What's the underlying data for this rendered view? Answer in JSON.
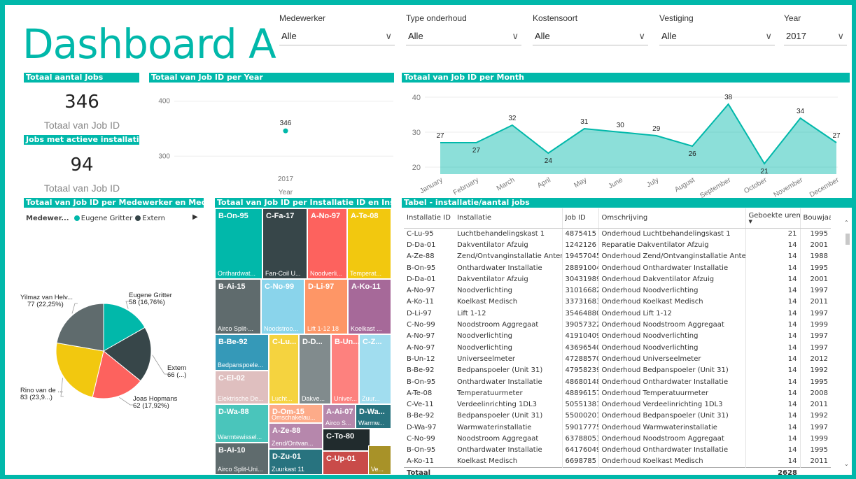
{
  "dashboard_title": "Dashboard A",
  "slicers": [
    {
      "label": "Medewerker",
      "value": "Alle"
    },
    {
      "label": "Type onderhoud",
      "value": "Alle"
    },
    {
      "label": "Kostensoort",
      "value": "Alle"
    },
    {
      "label": "Vestiging",
      "value": "Alle"
    },
    {
      "label": "Year",
      "value": "2017"
    }
  ],
  "cards": [
    {
      "title": "Totaal aantal Jobs",
      "value": "346",
      "caption": "Totaal van Job ID"
    },
    {
      "title": "Jobs met actieve installatie",
      "value": "94",
      "caption": "Totaal van Job ID"
    }
  ],
  "year_chart": {
    "title": "Totaal van Job ID per Year",
    "chart_data": {
      "type": "scatter",
      "categories": [
        "2017"
      ],
      "values": [
        346
      ],
      "xlabel": "Year",
      "ylim": [
        280,
        420
      ],
      "yticks": [
        "400",
        "300"
      ]
    }
  },
  "month_chart": {
    "title": "Totaal van Job ID per Month",
    "chart_data": {
      "type": "area",
      "categories": [
        "January",
        "February",
        "March",
        "April",
        "May",
        "June",
        "July",
        "August",
        "September",
        "October",
        "November",
        "December"
      ],
      "values": [
        27,
        27,
        32,
        24,
        31,
        30,
        29,
        26,
        38,
        21,
        34,
        27
      ],
      "ylim": [
        18,
        42
      ],
      "yticks": [
        40,
        30,
        20
      ],
      "color": "#01b8aa"
    }
  },
  "pie_chart": {
    "title": "Totaal van Job ID per Medewerker en Medewer...",
    "legend_title": "Medewer...",
    "legend": [
      {
        "name": "Eugene Gritter",
        "color": "#01b8aa"
      },
      {
        "name": "Extern",
        "color": "#374649"
      }
    ],
    "chart_data": {
      "type": "pie",
      "slices": [
        {
          "name": "Eugene Gritter",
          "value": 58,
          "label1": "Eugene Gritter",
          "label2": "58 (16,76%)",
          "color": "#01b8aa"
        },
        {
          "name": "Extern",
          "value": 66,
          "label1": "Extern",
          "label2": "66 (...)",
          "color": "#374649"
        },
        {
          "name": "Joas Hopmans",
          "value": 62,
          "label1": "Joas Hopmans",
          "label2": "62 (17,92%)",
          "color": "#fd625e"
        },
        {
          "name": "Rino van de",
          "value": 83,
          "label1": "Rino van de ...",
          "label2": "83 (23,9...)",
          "color": "#f2c80f"
        },
        {
          "name": "Yilmaz van Helv",
          "value": 77,
          "label1": "Yilmaz van Helv...",
          "label2": "77 (22,25%)",
          "color": "#5f6b6d"
        }
      ]
    }
  },
  "treemap": {
    "title": "Totaal van Job ID per Installatie ID en Installatie",
    "tiles": [
      {
        "h": "B-On-95",
        "f": "Onthardwat...",
        "color": "#01b8aa"
      },
      {
        "h": "C-Fa-17",
        "f": "Fan-Coil U...",
        "color": "#374649"
      },
      {
        "h": "A-No-97",
        "f": "Noodverli...",
        "color": "#fd625e"
      },
      {
        "h": "A-Te-08",
        "f": "Temperat...",
        "color": "#f2c80f"
      },
      {
        "h": "B-Ai-15",
        "f": "Airco Split-...",
        "color": "#5f6b6d"
      },
      {
        "h": "C-No-99",
        "f": "Noodstroo...",
        "color": "#8ad4eb"
      },
      {
        "h": "D-Li-97",
        "f": "Lift 1-12 18",
        "color": "#fe9666"
      },
      {
        "h": "A-Ko-11",
        "f": "Koelkast ...",
        "color": "#a66999"
      },
      {
        "h": "B-Be-92",
        "f": "Bedpanspoele...",
        "color": "#3599b8"
      },
      {
        "h": "C-Lu...",
        "f": "Lucht...",
        "color": "#f5d33f"
      },
      {
        "h": "D-D...",
        "f": "Dakve...",
        "color": "#818b8d"
      },
      {
        "h": "B-Un...",
        "f": "Univer...",
        "color": "#fd817e"
      },
      {
        "h": "C-Z...",
        "f": "Zuur...",
        "color": "#a1ddef"
      },
      {
        "h": "C-El-02",
        "f": "Elektrische De...",
        "color": "#dfbfbf"
      },
      {
        "h": "D-Om-15",
        "f": "Omschakelau...",
        "color": "#fdab89"
      },
      {
        "h": "A-Ai-07",
        "f": "Airco S...",
        "color": "#b687ac"
      },
      {
        "h": "D-Wa...",
        "f": "Warmw...",
        "color": "#28737f"
      },
      {
        "h": "D-Wa-88",
        "f": "Warmtewissel...",
        "color": "#4ac5bb"
      },
      {
        "h": "A-Ze-88",
        "f": "Zend/Ontvan...",
        "color": "#b687ac"
      },
      {
        "h": "C-To-80",
        "f": "",
        "color": "#212b2d"
      },
      {
        "h": "B-Ai-10",
        "f": "Airco Split-Uni...",
        "color": "#5f6b6d"
      },
      {
        "h": "D-Zu-01",
        "f": "Zuurkast 11",
        "color": "#28737f"
      },
      {
        "h": "C-Up-01",
        "f": "",
        "color": "#c94b49"
      },
      {
        "h": "",
        "f": "Ve...",
        "color": "#a89228"
      }
    ]
  },
  "table": {
    "title": "Tabel - installatie/aantal jobs",
    "columns": [
      "Installatie ID",
      "Installatie",
      "Job ID",
      "Omschrijving",
      "Geboekte uren",
      "Bouwjaar"
    ],
    "rows": [
      [
        "C-Lu-95",
        "Luchtbehandelingskast 1",
        "4875415",
        "Onderhoud Luchtbehandelingskast 1",
        "21",
        "1995"
      ],
      [
        "D-Da-01",
        "Dakventilator Afzuig",
        "1242126",
        "Reparatie Dakventilator Afzuig",
        "14",
        "2001"
      ],
      [
        "A-Ze-88",
        "Zend/Ontvanginstallatie Antenne",
        "19457045",
        "Onderhoud Zend/Ontvanginstallatie Antenne",
        "14",
        "1988"
      ],
      [
        "B-On-95",
        "Onthardwater Installatie",
        "28891004",
        "Onderhoud Onthardwater Installatie",
        "14",
        "1995"
      ],
      [
        "D-Da-01",
        "Dakventilator Afzuig",
        "30431989",
        "Onderhoud Dakventilator Afzuig",
        "14",
        "2001"
      ],
      [
        "A-No-97",
        "Noodverlichting",
        "31016682",
        "Onderhoud Noodverlichting",
        "14",
        "1997"
      ],
      [
        "A-Ko-11",
        "Koelkast Medisch",
        "33731683",
        "Onderhoud Koelkast Medisch",
        "14",
        "2011"
      ],
      [
        "D-Li-97",
        "Lift 1-12",
        "35464880",
        "Onderhoud Lift 1-12",
        "14",
        "1997"
      ],
      [
        "C-No-99",
        "Noodstroom Aggregaat",
        "39057322",
        "Onderhoud Noodstroom Aggregaat",
        "14",
        "1999"
      ],
      [
        "A-No-97",
        "Noodverlichting",
        "41910409",
        "Onderhoud Noodverlichting",
        "14",
        "1997"
      ],
      [
        "A-No-97",
        "Noodverlichting",
        "43696540",
        "Onderhoud Noodverlichting",
        "14",
        "1997"
      ],
      [
        "B-Un-12",
        "Universeelmeter",
        "47288570",
        "Onderhoud Universeelmeter",
        "14",
        "2012"
      ],
      [
        "B-Be-92",
        "Bedpanspoeler (Unit 31)",
        "47958239",
        "Onderhoud Bedpanspoeler (Unit 31)",
        "14",
        "1992"
      ],
      [
        "B-On-95",
        "Onthardwater Installatie",
        "48680148",
        "Onderhoud Onthardwater Installatie",
        "14",
        "1995"
      ],
      [
        "A-Te-08",
        "Temperatuurmeter",
        "48896157",
        "Onderhoud Temperatuurmeter",
        "14",
        "2008"
      ],
      [
        "C-Ve-11",
        "Verdeelinrichting 1DL3",
        "50551381",
        "Onderhoud Verdeelinrichting 1DL3",
        "14",
        "2011"
      ],
      [
        "B-Be-92",
        "Bedpanspoeler (Unit 31)",
        "55000201",
        "Onderhoud Bedpanspoeler (Unit 31)",
        "14",
        "1992"
      ],
      [
        "D-Wa-97",
        "Warmwaterinstallatie",
        "59017775",
        "Onderhoud Warmwaterinstallatie",
        "14",
        "1997"
      ],
      [
        "C-No-99",
        "Noodstroom Aggregaat",
        "63788053",
        "Onderhoud Noodstroom Aggregaat",
        "14",
        "1999"
      ],
      [
        "B-On-95",
        "Onthardwater Installatie",
        "64176049",
        "Onderhoud Onthardwater Installatie",
        "14",
        "1995"
      ],
      [
        "A-Ko-11",
        "Koelkast Medisch",
        "6698785",
        "Onderhoud Koelkast Medisch",
        "14",
        "2011"
      ]
    ],
    "total_label": "Totaal",
    "total_value": "2628"
  },
  "icons": {
    "chevron": "chevron-down-icon",
    "legend_next": "play-icon",
    "scroll_up": "scroll-up-icon",
    "scroll_down": "scroll-down-icon"
  }
}
